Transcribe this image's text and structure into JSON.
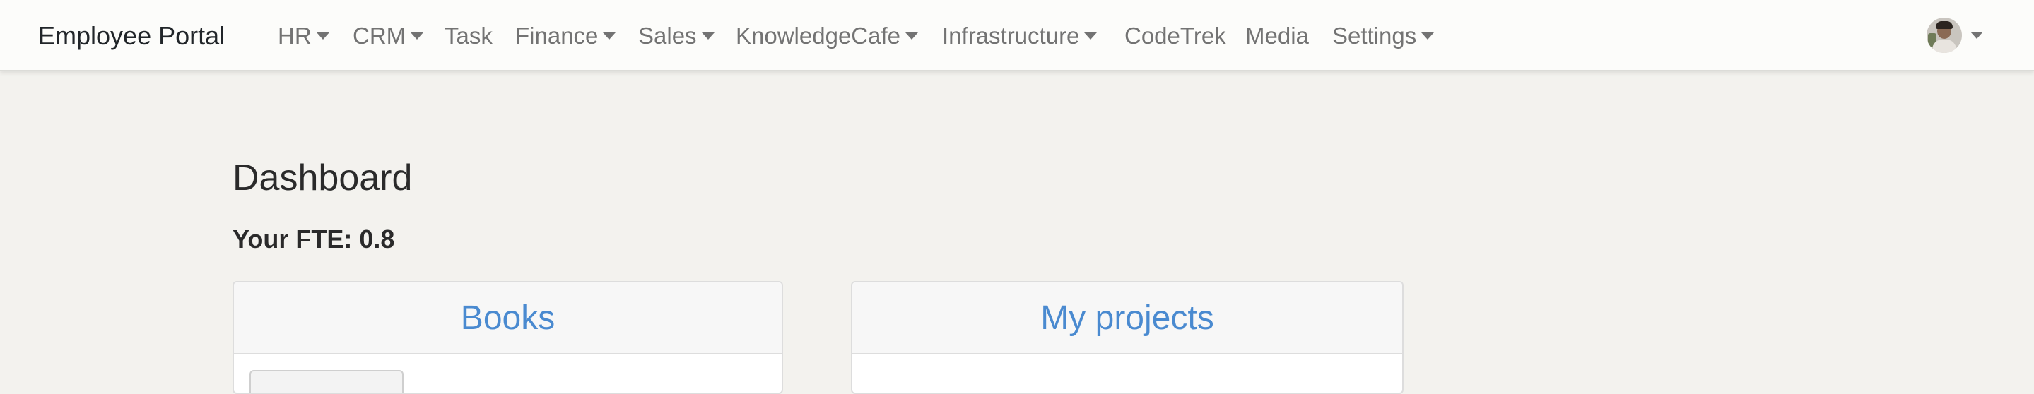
{
  "navbar": {
    "brand": "Employee Portal",
    "items": [
      {
        "label": "HR",
        "dropdown": true
      },
      {
        "label": "CRM",
        "dropdown": true
      },
      {
        "label": "Task",
        "dropdown": false
      },
      {
        "label": "Finance",
        "dropdown": true
      },
      {
        "label": "Sales",
        "dropdown": true
      },
      {
        "label": "KnowledgeCafe",
        "dropdown": true
      },
      {
        "label": "Infrastructure",
        "dropdown": true
      },
      {
        "label": "CodeTrek",
        "dropdown": false
      },
      {
        "label": "Media",
        "dropdown": false
      },
      {
        "label": "Settings",
        "dropdown": true
      }
    ]
  },
  "main": {
    "title": "Dashboard",
    "fte": "Your FTE: 0.8"
  },
  "cards": {
    "books": {
      "title": "Books"
    },
    "projects": {
      "title": "My projects"
    }
  },
  "colors": {
    "background": "#f3f2ee",
    "navbar": "#fcfcfa",
    "link": "#4a8ad0",
    "nav_text": "#737373"
  }
}
